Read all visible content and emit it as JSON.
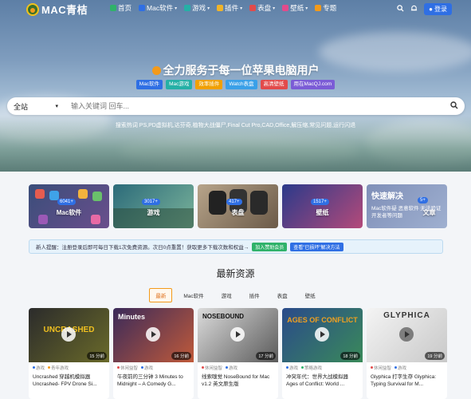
{
  "nav": {
    "logo_text": "MAC青桔",
    "items": [
      {
        "label": "首页",
        "icon": "home-icon",
        "color": "#2fb26a",
        "caret": ""
      },
      {
        "label": "Mac软件",
        "icon": "apps-icon",
        "color": "#2f6fe4",
        "caret": "▾"
      },
      {
        "label": "游戏",
        "icon": "gamepad-icon",
        "color": "#25b0a6",
        "caret": "▾"
      },
      {
        "label": "插件",
        "icon": "plugin-icon",
        "color": "#f0b429",
        "caret": "▾"
      },
      {
        "label": "表盘",
        "icon": "watch-icon",
        "color": "#e24b4b",
        "caret": "▾"
      },
      {
        "label": "壁纸",
        "icon": "wallpaper-icon",
        "color": "#e24b8b",
        "caret": "▾"
      },
      {
        "label": "专题",
        "icon": "topic-icon",
        "color": "#f39a1a",
        "caret": ""
      }
    ],
    "login_label": "登录"
  },
  "hero": {
    "slogan": "全力服务于每一位苹果电脑用户",
    "tags": [
      {
        "label": "Mac软件",
        "color": "#2f6fe4"
      },
      {
        "label": "Mac游戏",
        "color": "#25b0a6"
      },
      {
        "label": "效率插件",
        "color": "#f0a000"
      },
      {
        "label": "Watch表盘",
        "color": "#3aa0e8"
      },
      {
        "label": "高清壁纸",
        "color": "#e24b4b"
      },
      {
        "label": "用在MacQJ.com",
        "color": "#7b5cd6"
      }
    ],
    "search": {
      "scope": "全站",
      "placeholder": "输入关键词 回车..."
    },
    "hot": "搜索热词  PS,PD虚拟机,达芬奇,植物大战僵尸,Final Cut Pro,CAD,Office,解压缩,常见问题,运行闪退"
  },
  "categories": [
    {
      "label": "Mac软件",
      "count": "6041+"
    },
    {
      "label": "游戏",
      "count": "3017+"
    },
    {
      "label": "表盘",
      "count": "417+"
    },
    {
      "label": "壁纸",
      "count": "1517+"
    },
    {
      "label": "文章",
      "count": "5+",
      "overlay_title": "快速解决",
      "overlay_sub": "Mac软件疑 恶意软件 无法验证开发者等问题"
    }
  ],
  "notice": {
    "text": "新人提醒：注册登录后即可每日下载1次免费资源。次日0点重置！获取更多下载次数和权益→",
    "btn1": "加入赞助会员",
    "btn2": "查看\"已损坏\"解决方法"
  },
  "latest": {
    "title": "最新资源",
    "filters": [
      "最新",
      "Mac软件",
      "游戏",
      "插件",
      "表盘",
      "壁纸"
    ],
    "posts": [
      {
        "thumb_text": "UNCRASHED",
        "duration": "15 分前",
        "tags": [
          "游戏",
          "青年游戏"
        ],
        "title": "Uncrashed 穿越机模拟器 Uncrashed- FPV Drone Si..."
      },
      {
        "thumb_text": "Minutes",
        "duration": "16 分前",
        "tags": [
          "休闲益智",
          "游戏"
        ],
        "title": "午夜前的三分钟 3 Minutes to Midnight – A Comedy G..."
      },
      {
        "thumb_text": "NOSEBOUND",
        "duration": "17 分前",
        "tags": [
          "休闲益智",
          "游戏"
        ],
        "title": "线索嗅觉 NoseBound for Mac v1.2 英文原生版"
      },
      {
        "thumb_text": "AGES OF CONFLICT",
        "duration": "18 分前",
        "tags": [
          "游戏",
          "策略游戏"
        ],
        "title": "冲突年代：世界大战模拟器 Ages of Conflict: World ..."
      },
      {
        "thumb_text": "GLYPHICA",
        "duration": "19 分前",
        "tags": [
          "休闲益智",
          "游戏"
        ],
        "title": "Glyphica 打字生存 Glyphica: Typing Survival for M..."
      }
    ]
  }
}
